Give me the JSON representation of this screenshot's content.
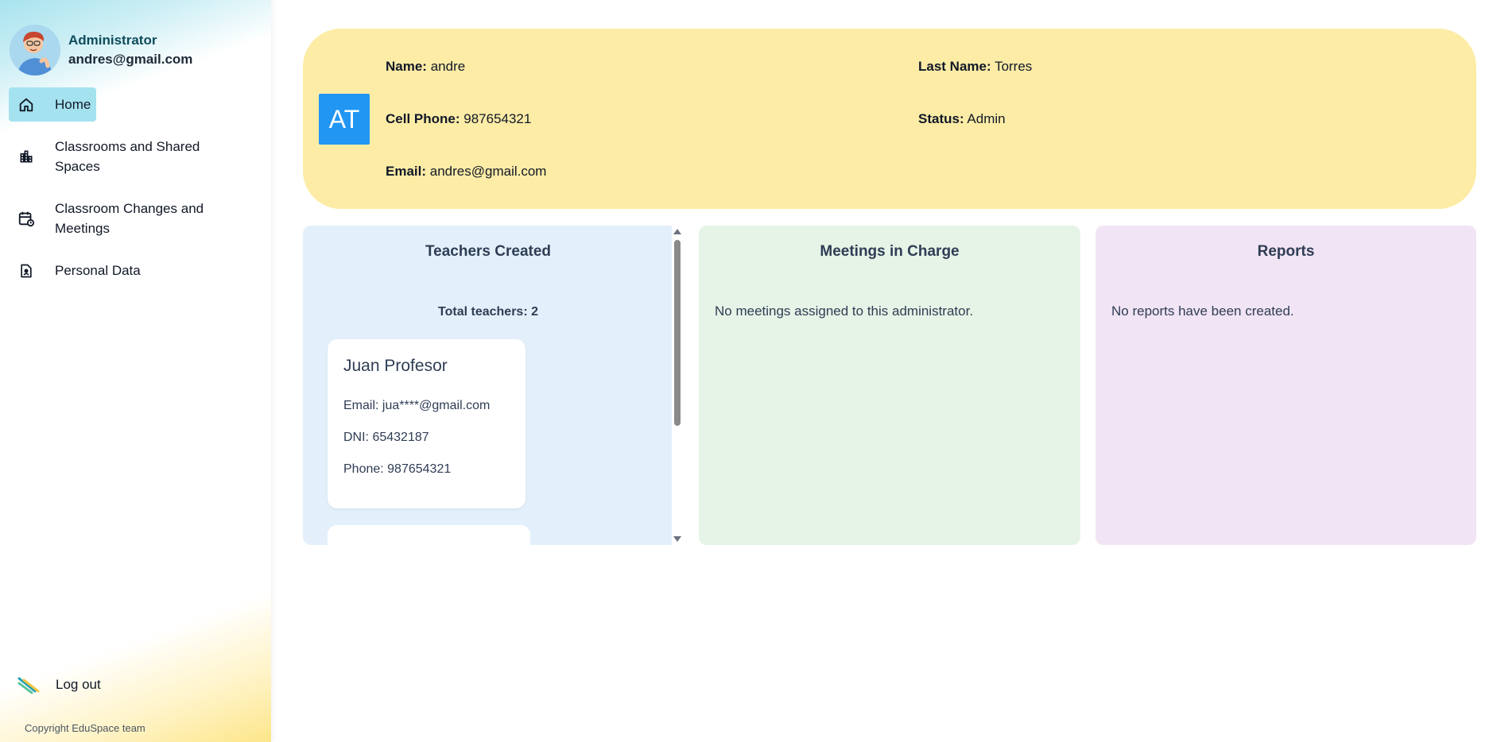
{
  "sidebar": {
    "role": "Administrator",
    "email": "andres@gmail.com",
    "items": [
      {
        "label": "Home",
        "icon": "home-icon"
      },
      {
        "label": "Classrooms and Shared Spaces",
        "icon": "building-icon"
      },
      {
        "label": "Classroom Changes and Meetings",
        "icon": "calendar-clock-icon"
      },
      {
        "label": "Personal Data",
        "icon": "document-person-icon"
      }
    ],
    "logout_label": "Log out",
    "copyright": "Copyright EduSpace team"
  },
  "profile": {
    "initials": "AT",
    "name_label": "Name:",
    "name": "andre",
    "last_name_label": "Last Name:",
    "last_name": "Torres",
    "phone_label": "Cell Phone:",
    "phone": "987654321",
    "status_label": "Status:",
    "status": "Admin",
    "email_label": "Email:",
    "email": "andres@gmail.com"
  },
  "teachers": {
    "title": "Teachers Created",
    "total": "Total teachers: 2",
    "list": [
      {
        "name": "Juan Profesor",
        "email": "Email: jua****@gmail.com",
        "dni": "DNI: 65432187",
        "phone": "Phone: 987654321"
      }
    ]
  },
  "meetings": {
    "title": "Meetings in Charge",
    "message": "No meetings assigned to this administrator."
  },
  "reports": {
    "title": "Reports",
    "message": "No reports have been created."
  },
  "colors": {
    "profile_card": "#fdeca6",
    "teachers_panel": "#e3f0fb",
    "meetings_panel": "#e5f4e6",
    "reports_panel": "#f1e4f4",
    "initials_bg": "#2196f3",
    "nav_active": "#a5e2ef"
  }
}
